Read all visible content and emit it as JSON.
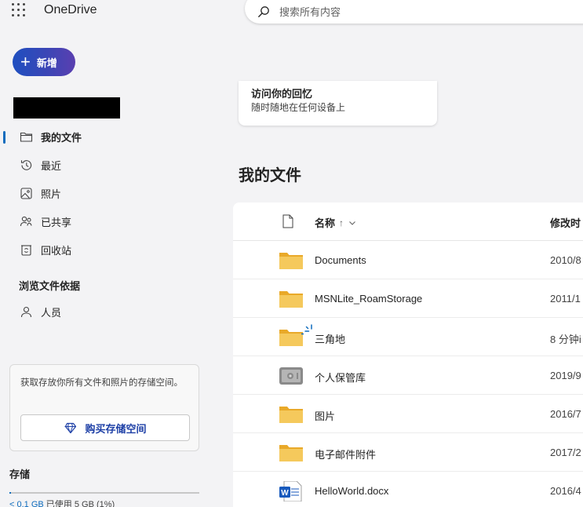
{
  "app": {
    "title": "OneDrive"
  },
  "actions": {
    "new_label": "新增"
  },
  "search": {
    "placeholder": "搜索所有内容"
  },
  "sidebar": {
    "items": [
      {
        "label": "我的文件",
        "icon": "folder-icon",
        "active": true
      },
      {
        "label": "最近",
        "icon": "history-icon"
      },
      {
        "label": "照片",
        "icon": "image-icon"
      },
      {
        "label": "已共享",
        "icon": "people-share-icon"
      },
      {
        "label": "回收站",
        "icon": "recycle-bin-icon"
      }
    ],
    "browse_title": "浏览文件依据",
    "people_label": "人员"
  },
  "storage": {
    "promo_text": "获取存放你所有文件和照片的存储空间。",
    "buy_label": "购买存储空间",
    "title": "存储",
    "used_amount": "< 0.1 GB",
    "used_text": "已使用 5 GB (1%)",
    "used_fraction": 0.01
  },
  "memories": {
    "title": "访问你的回忆",
    "subtitle": "随时随地在任何设备上"
  },
  "main": {
    "title": "我的文件",
    "columns": {
      "name": "名称",
      "sort_arrow": "↑",
      "modified": "修改时"
    },
    "files": [
      {
        "name": "Documents",
        "icon": "folder-icon",
        "modified": "2010/8"
      },
      {
        "name": "MSNLite_RoamStorage",
        "icon": "folder-icon",
        "modified": "2011/1"
      },
      {
        "name": "三角地",
        "icon": "folder-syncing-icon",
        "modified": "8 分钟i"
      },
      {
        "name": "个人保管库",
        "icon": "vault-icon",
        "modified": "2019/9"
      },
      {
        "name": "图片",
        "icon": "folder-icon",
        "modified": "2016/7"
      },
      {
        "name": "电子邮件附件",
        "icon": "folder-icon",
        "modified": "2017/2"
      },
      {
        "name": "HelloWorld.docx",
        "icon": "word-doc-icon",
        "modified": "2016/4"
      }
    ]
  },
  "colors": {
    "accent": "#0f6cbd",
    "folder": "#f4c75a",
    "word": "#185abd"
  }
}
